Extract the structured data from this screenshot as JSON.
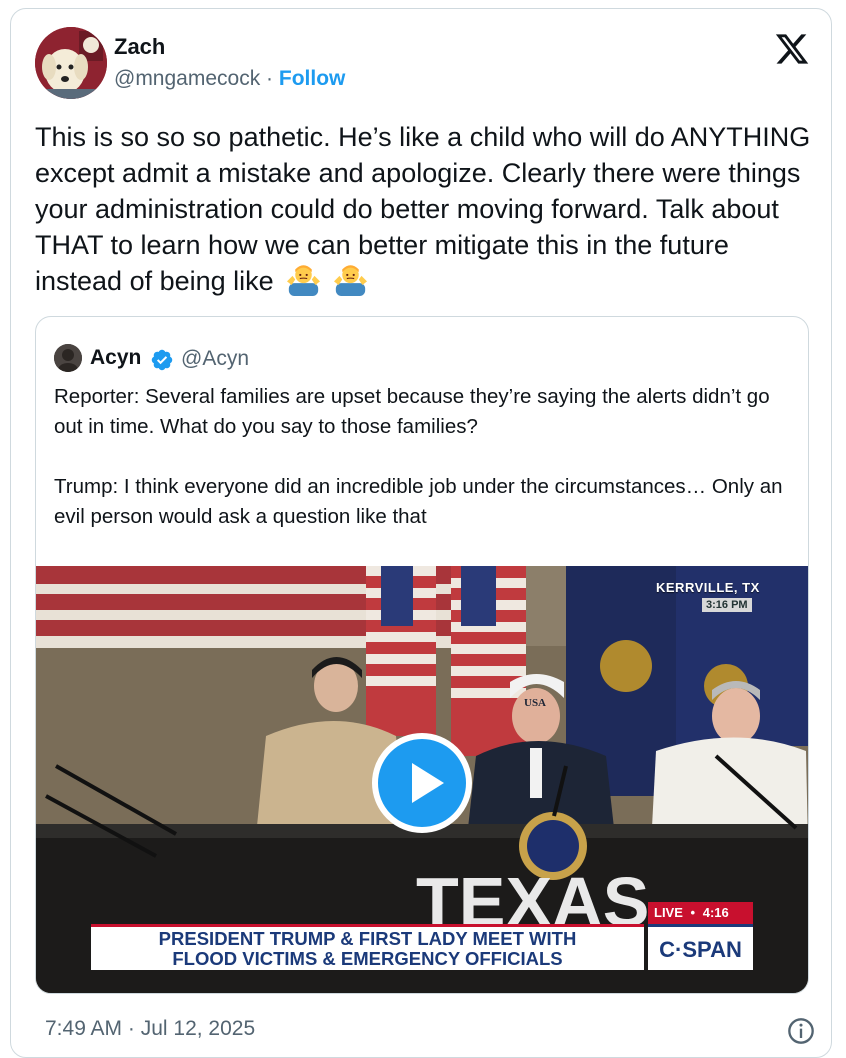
{
  "author": {
    "name": "Zach",
    "handle": "@mngamecock",
    "separator": "·",
    "follow_label": "Follow",
    "avatar_icon": "dog-avatar-icon"
  },
  "brand": {
    "logo": "x-logo-icon"
  },
  "tweet": {
    "text": "This is so so so pathetic. He’s like a child who will do ANYTHING except admit a mistake and apologize. Clearly there were things your administration could do better moving forward. Talk about THAT to learn how we can better mitigate this in the future instead of being like",
    "emojis": [
      "man-shrugging-emoji",
      "man-shrugging-emoji"
    ]
  },
  "quoted": {
    "name": "Acyn",
    "handle": "@Acyn",
    "verified_icon": "verified-badge-icon",
    "paragraph_1": "Reporter: Several families are upset because they’re saying the alerts didn’t go out in time. What do you say to those families?",
    "paragraph_2": "Trump: I think everyone did an incredible job under the circumstances… Only an evil person would ask a question like that",
    "video": {
      "location": "KERRVILLE, TX",
      "local_time": "3:16 PM",
      "banner_text": "TEXAS",
      "chyron_line_1": "PRESIDENT TRUMP & FIRST LADY MEET WITH",
      "chyron_line_2": "FLOOD VICTIMS & EMERGENCY OFFICIALS",
      "live_label": "LIVE",
      "live_time": "4:16",
      "network": "C·SPAN",
      "cap_text": "USA",
      "play_icon": "play-icon"
    }
  },
  "footer": {
    "timestamp": "7:49 AM · Jul 12, 2025",
    "info_icon": "info-icon"
  },
  "colors": {
    "text": "#0f1419",
    "muted": "#536471",
    "accent": "#1d9bf0",
    "border": "#cfd9de",
    "chyron_red": "#c8102e",
    "chyron_blue": "#1b3a7a"
  }
}
